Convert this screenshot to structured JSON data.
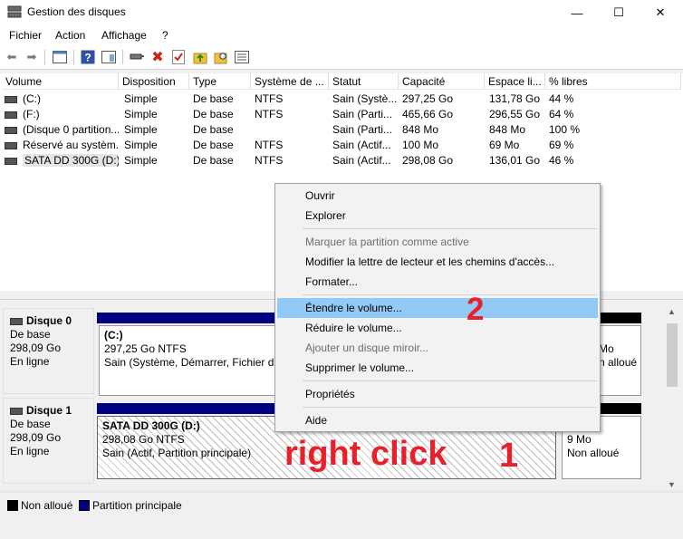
{
  "window": {
    "title": "Gestion des disques",
    "min": "—",
    "max": "☐",
    "close": "✕"
  },
  "menu": [
    "Fichier",
    "Action",
    "Affichage",
    "?"
  ],
  "table": {
    "columns": [
      "Volume",
      "Disposition",
      "Type",
      "Système de ...",
      "Statut",
      "Capacité",
      "Espace li...",
      "% libres"
    ],
    "rows": [
      [
        "(C:)",
        "Simple",
        "De base",
        "NTFS",
        "Sain (Systè...",
        "297,25 Go",
        "131,78 Go",
        "44 %"
      ],
      [
        "(F:)",
        "Simple",
        "De base",
        "NTFS",
        "Sain (Parti...",
        "465,66 Go",
        "296,55 Go",
        "64 %"
      ],
      [
        "(Disque 0 partition...",
        "Simple",
        "De base",
        "",
        "Sain (Parti...",
        "848 Mo",
        "848 Mo",
        "100 %"
      ],
      [
        "Réservé au systèm...",
        "Simple",
        "De base",
        "NTFS",
        "Sain (Actif...",
        "100 Mo",
        "69 Mo",
        "69 %"
      ],
      [
        "SATA DD 300G (D:)",
        "Simple",
        "De base",
        "NTFS",
        "Sain (Actif...",
        "298,08 Go",
        "136,01 Go",
        "46 %"
      ]
    ]
  },
  "disks": [
    {
      "name": "Disque 0",
      "type": "De base",
      "size": "298,09 Go",
      "status": "En ligne",
      "partition": {
        "name": "(C:)",
        "size": "297,25 Go NTFS",
        "status": "Sain (Système, Démarrer, Fichier d'é"
      },
      "right": {
        "size": "Mo",
        "status": "n alloué"
      }
    },
    {
      "name": "Disque 1",
      "type": "De base",
      "size": "298,09 Go",
      "status": "En ligne",
      "partition": {
        "name": "SATA DD 300G  (D:)",
        "size": "298,08 Go NTFS",
        "status": "Sain (Actif, Partition principale)"
      },
      "right": {
        "size": "9 Mo",
        "status": "Non alloué"
      }
    }
  ],
  "legend": {
    "unallocated": "Non alloué",
    "primary": "Partition principale",
    "colors": {
      "unallocated": "#000000",
      "primary": "#000080"
    }
  },
  "context_menu": {
    "items": [
      {
        "label": "Ouvrir",
        "disabled": false
      },
      {
        "label": "Explorer",
        "disabled": false
      },
      {
        "label": "Marquer la partition comme active",
        "disabled": true
      },
      {
        "label": "Modifier la lettre de lecteur et les chemins d'accès...",
        "disabled": false
      },
      {
        "label": "Formater...",
        "disabled": false
      },
      {
        "label": "Étendre le volume...",
        "disabled": false,
        "highlighted": true
      },
      {
        "label": "Réduire le volume...",
        "disabled": false
      },
      {
        "label": "Ajouter un disque miroir...",
        "disabled": true
      },
      {
        "label": "Supprimer le volume...",
        "disabled": false
      },
      {
        "label": "Propriétés",
        "disabled": false
      },
      {
        "label": "Aide",
        "disabled": false
      }
    ]
  },
  "annotations": {
    "step2": "2",
    "right_click": "right click",
    "step1": "1",
    "color": "#e8202a"
  }
}
